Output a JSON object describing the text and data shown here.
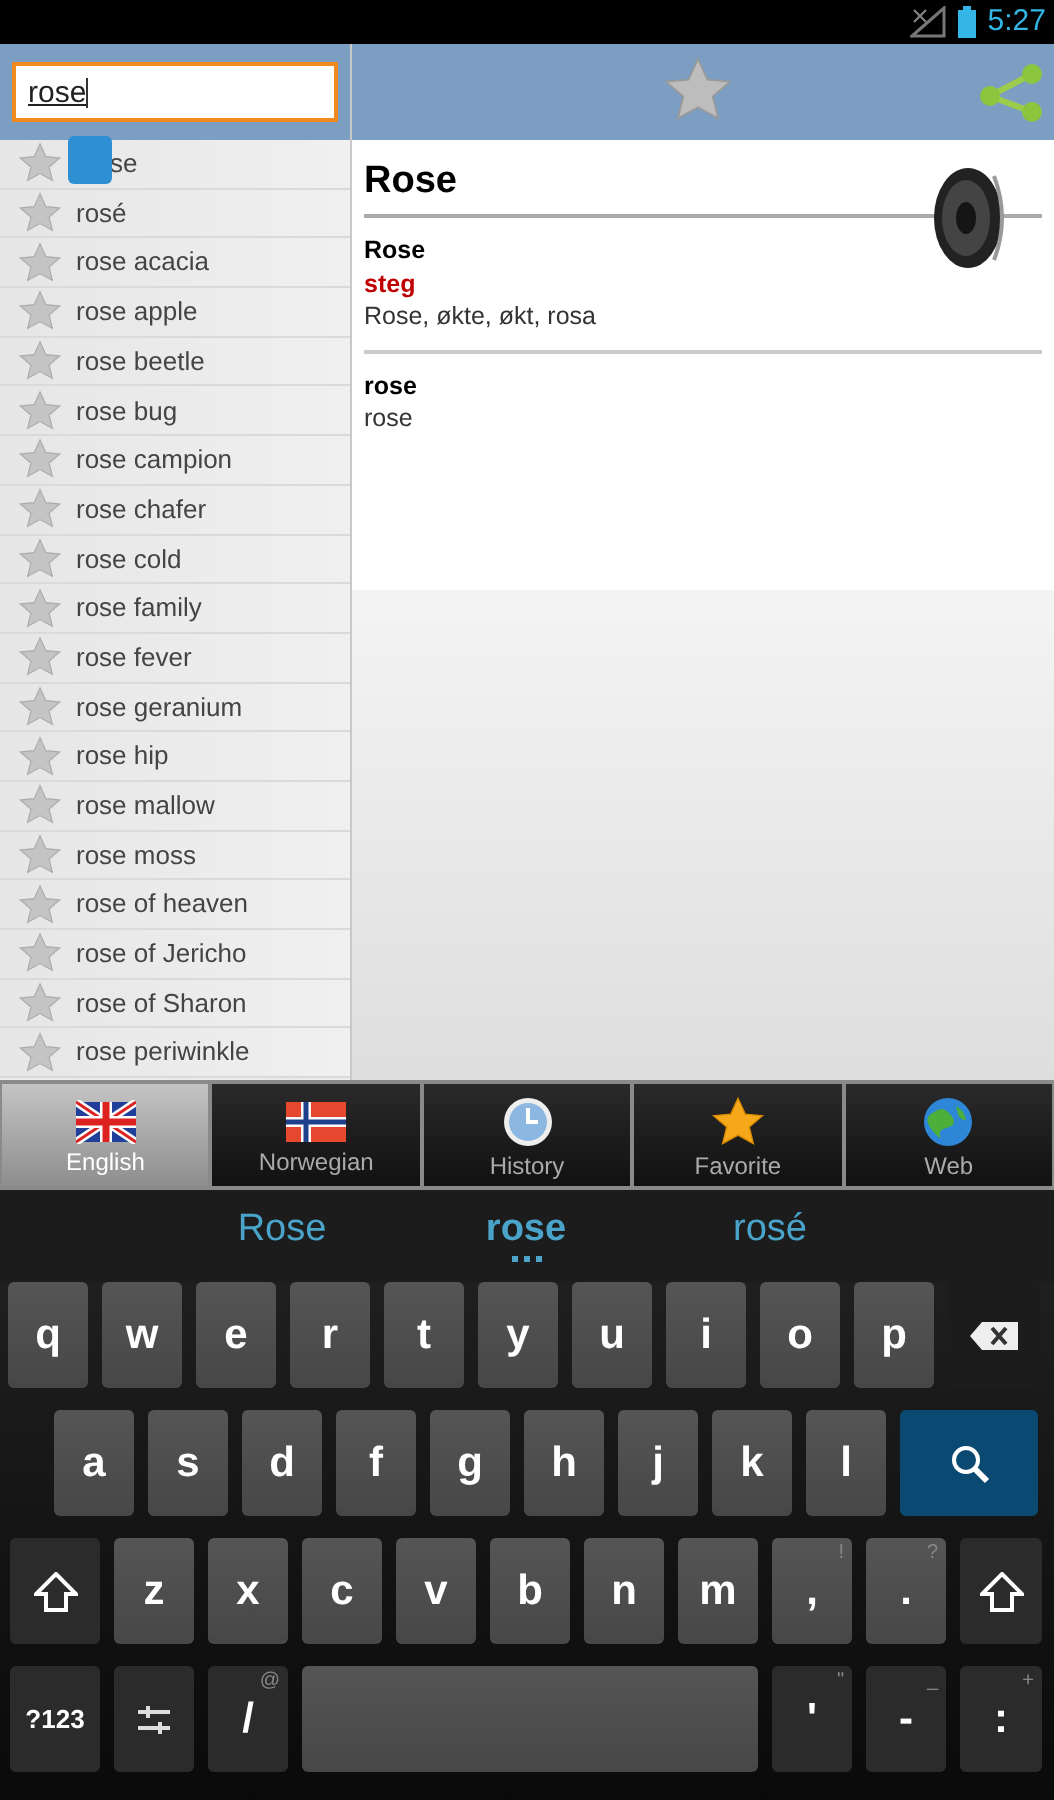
{
  "status_bar": {
    "time": "5:27"
  },
  "search": {
    "value": "rose"
  },
  "words": [
    "se",
    "rosé",
    "rose acacia",
    "rose apple",
    "rose beetle",
    "rose bug",
    "rose campion",
    "rose chafer",
    "rose cold",
    "rose family",
    "rose fever",
    "rose geranium",
    "rose hip",
    "rose mallow",
    "rose moss",
    "rose of heaven",
    "rose of Jericho",
    "rose of Sharon",
    "rose periwinkle"
  ],
  "entry": {
    "title": "Rose",
    "senses": [
      {
        "headword": "Rose",
        "grammar": "steg",
        "translation": "Rose, økte, økt, rosa"
      },
      {
        "headword": "rose",
        "translation": "rose"
      }
    ]
  },
  "tabs": [
    {
      "kind": "english",
      "label": "English",
      "selected": true
    },
    {
      "kind": "norwegian",
      "label": "Norwegian",
      "selected": false
    },
    {
      "kind": "history",
      "label": "History",
      "selected": false
    },
    {
      "kind": "favorite",
      "label": "Favorite",
      "selected": false
    },
    {
      "kind": "web",
      "label": "Web",
      "selected": false
    }
  ],
  "suggestions": [
    {
      "text": "Rose",
      "selected": false
    },
    {
      "text": "rose",
      "selected": true
    },
    {
      "text": "rosé",
      "selected": false
    }
  ],
  "keyboard": {
    "rows": [
      [
        {
          "kind": "char",
          "label": "q"
        },
        {
          "kind": "char",
          "label": "w"
        },
        {
          "kind": "char",
          "label": "e"
        },
        {
          "kind": "char",
          "label": "r"
        },
        {
          "kind": "char",
          "label": "t"
        },
        {
          "kind": "char",
          "label": "y"
        },
        {
          "kind": "char",
          "label": "u"
        },
        {
          "kind": "char",
          "label": "i"
        },
        {
          "kind": "char",
          "label": "o"
        },
        {
          "kind": "char",
          "label": "p"
        },
        {
          "kind": "backspace"
        }
      ],
      [
        {
          "kind": "char",
          "label": "a"
        },
        {
          "kind": "char",
          "label": "s"
        },
        {
          "kind": "char",
          "label": "d"
        },
        {
          "kind": "char",
          "label": "f"
        },
        {
          "kind": "char",
          "label": "g"
        },
        {
          "kind": "char",
          "label": "h"
        },
        {
          "kind": "char",
          "label": "j"
        },
        {
          "kind": "char",
          "label": "k"
        },
        {
          "kind": "char",
          "label": "l"
        },
        {
          "kind": "search"
        }
      ],
      [
        {
          "kind": "shift"
        },
        {
          "kind": "char",
          "label": "z"
        },
        {
          "kind": "char",
          "label": "x"
        },
        {
          "kind": "char",
          "label": "c"
        },
        {
          "kind": "char",
          "label": "v"
        },
        {
          "kind": "char",
          "label": "b"
        },
        {
          "kind": "char",
          "label": "n"
        },
        {
          "kind": "char",
          "label": "m"
        },
        {
          "kind": "char",
          "label": ",",
          "hint": "!"
        },
        {
          "kind": "char",
          "label": ".",
          "hint": "?"
        },
        {
          "kind": "shift"
        }
      ],
      [
        {
          "kind": "symbols",
          "label": "?123"
        },
        {
          "kind": "settings"
        },
        {
          "kind": "fn",
          "label": "/",
          "hint": "@"
        },
        {
          "kind": "space"
        },
        {
          "kind": "fn",
          "label": "'",
          "hint": "\""
        },
        {
          "kind": "fn",
          "label": "-",
          "hint": "_"
        },
        {
          "kind": "fn",
          "label": ":",
          "hint": "+"
        }
      ]
    ]
  }
}
